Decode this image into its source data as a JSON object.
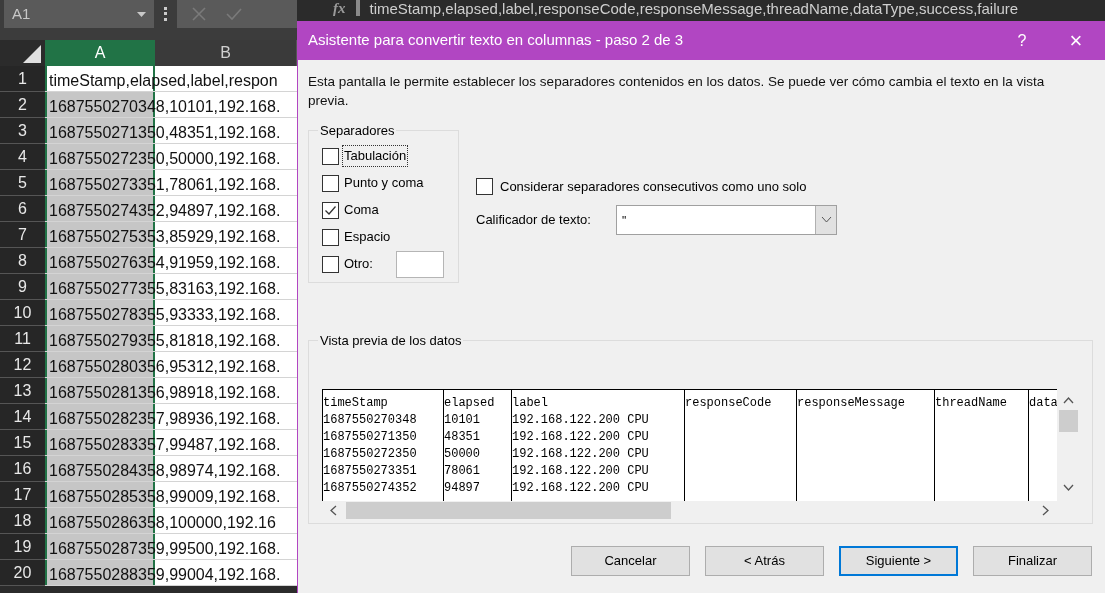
{
  "excel": {
    "name_box": "A1",
    "function_label": "fx",
    "formula": "timeStamp,elapsed,label,responseCode,responseMessage,threadName,dataType,success,failure",
    "columns": [
      {
        "label": "A",
        "selected": true
      },
      {
        "label": "B",
        "selected": false
      }
    ],
    "rows": [
      {
        "number": "1",
        "text": "timeStamp,elapsed,label,respon"
      },
      {
        "number": "2",
        "text": "1687550270348,10101,192.168."
      },
      {
        "number": "3",
        "text": "1687550271350,48351,192.168."
      },
      {
        "number": "4",
        "text": "1687550272350,50000,192.168."
      },
      {
        "number": "5",
        "text": "1687550273351,78061,192.168."
      },
      {
        "number": "6",
        "text": "1687550274352,94897,192.168."
      },
      {
        "number": "7",
        "text": "1687550275353,85929,192.168."
      },
      {
        "number": "8",
        "text": "1687550276354,91959,192.168."
      },
      {
        "number": "9",
        "text": "1687550277355,83163,192.168."
      },
      {
        "number": "10",
        "text": "1687550278355,93333,192.168."
      },
      {
        "number": "11",
        "text": "1687550279355,81818,192.168."
      },
      {
        "number": "12",
        "text": "1687550280356,95312,192.168."
      },
      {
        "number": "13",
        "text": "1687550281356,98918,192.168."
      },
      {
        "number": "14",
        "text": "1687550282357,98936,192.168."
      },
      {
        "number": "15",
        "text": "1687550283357,99487,192.168."
      },
      {
        "number": "16",
        "text": "1687550284358,98974,192.168."
      },
      {
        "number": "17",
        "text": "1687550285358,99009,192.168."
      },
      {
        "number": "18",
        "text": "1687550286358,100000,192.16"
      },
      {
        "number": "19",
        "text": "1687550287359,99500,192.168."
      },
      {
        "number": "20",
        "text": "1687550288359,99004,192.168."
      }
    ]
  },
  "dialog": {
    "title": "Asistente para convertir texto en columnas - paso 2 de 3",
    "help": "?",
    "close": "×",
    "description": "Esta pantalla le permite establecer los separadores contenidos en los datos. Se puede ver cómo cambia el texto en la vista previa.",
    "separators": {
      "legend": "Separadores",
      "items": [
        {
          "kind": "checkbox",
          "label": "Tabulación",
          "checked": false,
          "focused": true
        },
        {
          "kind": "checkbox",
          "label": "Punto y coma",
          "checked": false,
          "focused": false
        },
        {
          "kind": "checkbox",
          "label": "Coma",
          "checked": true,
          "focused": false
        },
        {
          "kind": "checkbox",
          "label": "Espacio",
          "checked": false,
          "focused": false
        },
        {
          "kind": "checkbox_field",
          "label": "Otro:",
          "checked": false,
          "focused": false
        }
      ]
    },
    "consecutive": {
      "label": "Considerar separadores consecutivos como uno solo",
      "checked": false
    },
    "qualifier": {
      "label": "Calificador de texto:",
      "value": "\""
    },
    "preview": {
      "legend": "Vista previa de los datos",
      "columns": [
        {
          "header": "timeStamp",
          "cells": [
            "1687550270348",
            "1687550271350",
            "1687550272350",
            "1687550273351",
            "1687550274352"
          ]
        },
        {
          "header": "elapsed",
          "cells": [
            "10101",
            "48351",
            "50000",
            "78061",
            "94897"
          ]
        },
        {
          "header": "label",
          "cells": [
            "192.168.122.200 CPU",
            "192.168.122.200 CPU",
            "192.168.122.200 CPU",
            "192.168.122.200 CPU",
            "192.168.122.200 CPU"
          ]
        },
        {
          "header": "responseCode"
        },
        {
          "header": "responseMessage"
        },
        {
          "header": "threadName"
        },
        {
          "header": "data"
        }
      ]
    },
    "buttons": [
      {
        "label": "Cancelar",
        "default": false
      },
      {
        "label": "< Atrás",
        "default": false
      },
      {
        "label": "Siguiente >",
        "default": true
      },
      {
        "label": "Finalizar",
        "default": false
      }
    ]
  }
}
